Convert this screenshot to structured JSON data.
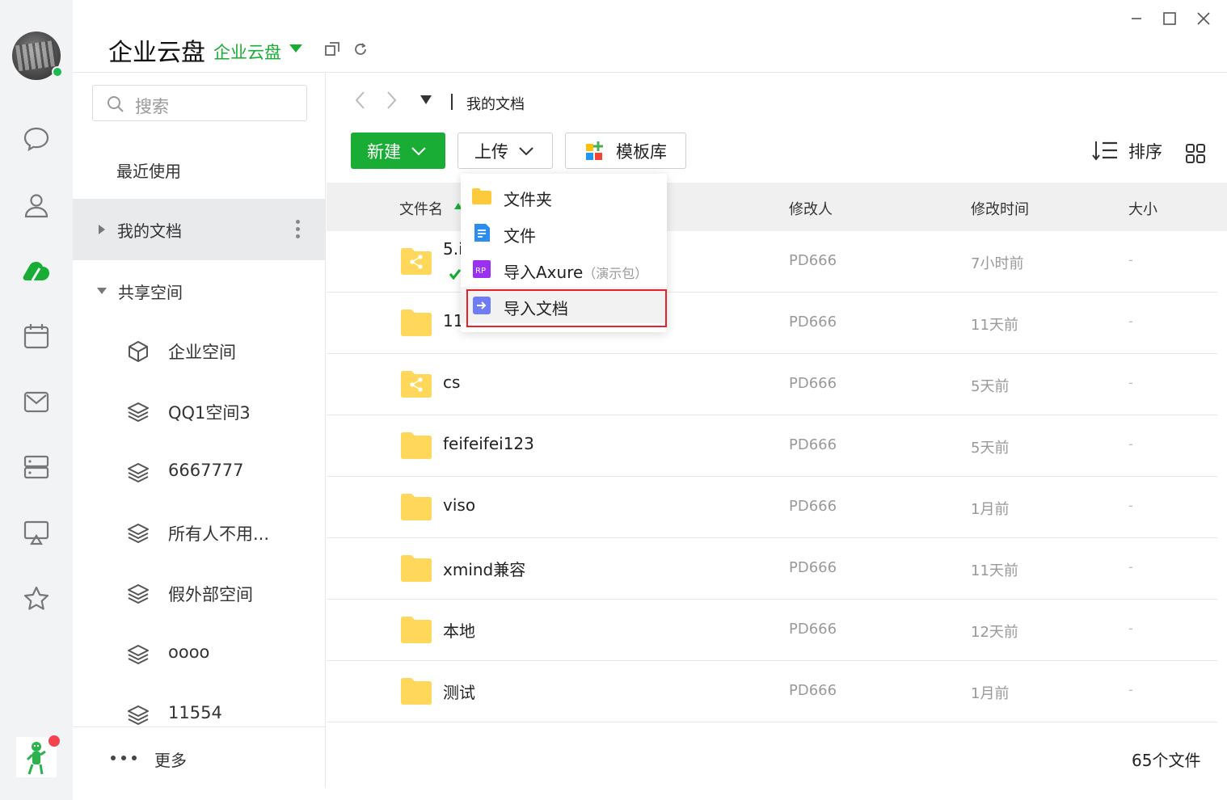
{
  "app": {
    "title": "企业云盘",
    "subtitle": "企业云盘"
  },
  "colors": {
    "brand_green": "#1aad35",
    "highlight_red": "#e5222a",
    "folder_yellow": "#ffd75a"
  },
  "rail": {
    "items": [
      "chat-icon",
      "contacts-icon",
      "cloud-drive-icon",
      "calendar-icon",
      "mail-icon",
      "storage-icon",
      "screen-share-icon",
      "star-icon"
    ]
  },
  "sidebar": {
    "search_placeholder": "搜索",
    "recent": "最近使用",
    "my_docs": "我的文档",
    "shared": "共享空间",
    "spaces": [
      {
        "label": "企业空间",
        "icon": "cube-icon"
      },
      {
        "label": "QQ1空间3",
        "icon": "layers-icon"
      },
      {
        "label": "6667777",
        "icon": "layers-icon"
      },
      {
        "label": "所有人不用...",
        "icon": "layers-icon"
      },
      {
        "label": "假外部空间",
        "icon": "layers-icon"
      },
      {
        "label": "oooo",
        "icon": "layers-icon"
      },
      {
        "label": "11554",
        "icon": "layers-icon"
      }
    ],
    "more": "更多"
  },
  "breadcrumb": {
    "current": "我的文档"
  },
  "toolbar": {
    "new_label": "新建",
    "upload_label": "上传",
    "template_label": "模板库",
    "sort_label": "排序"
  },
  "upload_menu": {
    "items": [
      {
        "label": "文件夹",
        "note": ""
      },
      {
        "label": "文件",
        "note": ""
      },
      {
        "label": "导入Axure",
        "note": "（演示包）"
      },
      {
        "label": "导入文档",
        "note": ""
      }
    ],
    "highlighted_index": 3
  },
  "table": {
    "columns": [
      "文件名",
      "修改人",
      "修改时间",
      "大小"
    ],
    "rows": [
      {
        "name": "5.i",
        "shared": true,
        "modified_by": "PD666",
        "modified": "7小时前",
        "size": "-"
      },
      {
        "name": "11",
        "shared": false,
        "modified_by": "PD666",
        "modified": "11天前",
        "size": "-"
      },
      {
        "name": "cs",
        "shared": true,
        "modified_by": "PD666",
        "modified": "5天前",
        "size": "-"
      },
      {
        "name": "feifeifei123",
        "shared": false,
        "modified_by": "PD666",
        "modified": "5天前",
        "size": "-"
      },
      {
        "name": "viso",
        "shared": false,
        "modified_by": "PD666",
        "modified": "1月前",
        "size": "-"
      },
      {
        "name": "xmind兼容",
        "shared": false,
        "modified_by": "PD666",
        "modified": "11天前",
        "size": "-"
      },
      {
        "name": "本地",
        "shared": false,
        "modified_by": "PD666",
        "modified": "12天前",
        "size": "-"
      },
      {
        "name": "测试",
        "shared": false,
        "modified_by": "PD666",
        "modified": "1月前",
        "size": "-"
      }
    ]
  },
  "footer": {
    "file_count": "65个文件"
  }
}
